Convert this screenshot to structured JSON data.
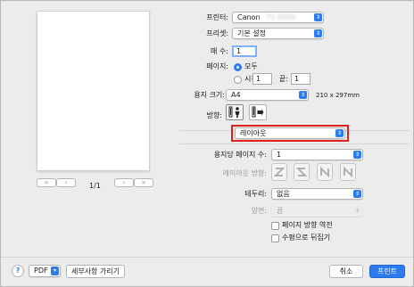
{
  "printer": {
    "label": "프린터:",
    "value": "Canon",
    "blurred": "TS 6000"
  },
  "presets": {
    "label": "프리셋:",
    "value": "기본 설정"
  },
  "copies": {
    "label": "매 수:",
    "value": "1"
  },
  "pages": {
    "label": "페이지:",
    "all": "모두",
    "from_label": "시작:",
    "from": "1",
    "to_label": "끝:",
    "to": "1"
  },
  "paper_size": {
    "label": "용지 크기:",
    "value": "A4",
    "dimensions": "210 x 297mm"
  },
  "orientation": {
    "label": "방향:"
  },
  "section": {
    "value": "레이아웃"
  },
  "layout": {
    "pages_per_sheet": {
      "label": "용지당 페이지 수:",
      "value": "1"
    },
    "direction_label": "레이아웃 방향:",
    "border": {
      "label": "테두리:",
      "value": "없음"
    },
    "two_sided": {
      "label": "양면:",
      "value": "끔"
    },
    "reverse": "페이지 방향 역전",
    "flip": "수평으로 뒤집기"
  },
  "preview": {
    "page_indicator": "1/1",
    "first": "«",
    "prev": "‹",
    "next": "›",
    "last": "»"
  },
  "footer": {
    "help": "?",
    "pdf": "PDF",
    "details": "세부사항 가리기",
    "cancel": "취소",
    "print": "프린트"
  },
  "colors": {
    "accent": "#2d7bf0",
    "highlight": "#e0201b"
  }
}
